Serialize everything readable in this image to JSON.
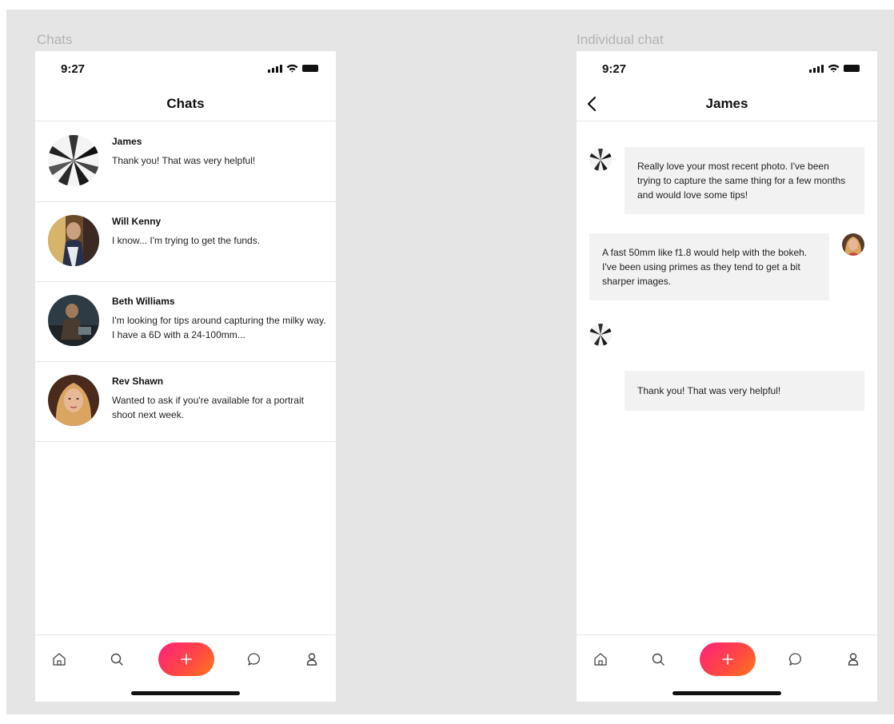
{
  "frames": {
    "chats_label": "Chats",
    "individual_label": "Individual chat"
  },
  "status_bar": {
    "time": "9:27"
  },
  "chats_screen": {
    "title": "Chats",
    "items": [
      {
        "name": "James",
        "preview": "Thank you! That was very helpful!",
        "avatar": "camera-lens-photo"
      },
      {
        "name": "Will Kenny",
        "preview": "I know... I'm trying to get the funds.",
        "avatar": "person-photo"
      },
      {
        "name": "Beth Williams",
        "preview": "I'm looking for tips around capturing the milky way. I have a 6D with a 24-100mm...",
        "avatar": "person-photo"
      },
      {
        "name": "Rev Shawn",
        "preview": "Wanted to ask if you're available for a portrait shoot next week.",
        "avatar": "person-photo"
      }
    ]
  },
  "chat_screen": {
    "title": "James",
    "messages": [
      {
        "direction": "incoming",
        "text": "Really love your most recent photo. I've been trying to capture the same thing for a few months and would love some tips!"
      },
      {
        "direction": "outgoing",
        "text": "A fast 50mm like f1.8 would help with the bokeh. I've been using primes as they tend to get a bit sharper images."
      },
      {
        "direction": "incoming",
        "text": "Thank you! That was very helpful!"
      }
    ]
  },
  "tab_bar": {
    "items": [
      "home-icon",
      "search-icon",
      "plus-icon",
      "chat-bubble-icon",
      "profile-icon"
    ],
    "fab_colors": [
      "#ff1f7d",
      "#ff4b3e",
      "#ff7a1c"
    ]
  },
  "colors": {
    "canvas": "#e5e5e5",
    "bubble": "#f2f2f2",
    "divider": "#e6e6e6",
    "label": "#b3b3b3"
  }
}
